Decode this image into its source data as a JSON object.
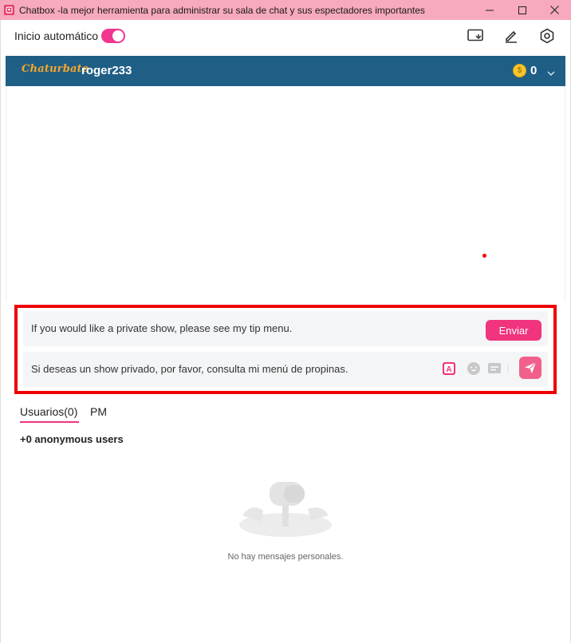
{
  "window": {
    "title": "Chatbox -la mejor herramienta para administrar su sala de chat y sus espectadores importantes",
    "controls": [
      "minimize-icon",
      "maximize-icon",
      "close-icon"
    ]
  },
  "toolbar": {
    "auto_start_label": "Inicio automático",
    "auto_start_enabled": true,
    "icons": [
      "screen-share-icon",
      "edit-icon",
      "settings-icon"
    ],
    "accent_color": "#f0368f"
  },
  "channel": {
    "platform_logo": "Chaturbate",
    "username": "roger233",
    "coins": "0",
    "header_color": "#1f5f86"
  },
  "translation": {
    "english_text": "If you would like a private show, please see my tip menu.",
    "send_label": "Enviar",
    "spanish_text": "Si deseas un show privado, por favor, consulta mi menú de propinas.",
    "icons": [
      "translate-icon",
      "emoji-icon",
      "message-icon",
      "send-icon"
    ]
  },
  "tabs": [
    {
      "label": "Usuarios(0)",
      "active": true
    },
    {
      "label": "PM",
      "active": false
    }
  ],
  "users": {
    "anonymous_count": "+0 anonymous users"
  },
  "empty_state": {
    "message": "No hay mensajes personales."
  }
}
